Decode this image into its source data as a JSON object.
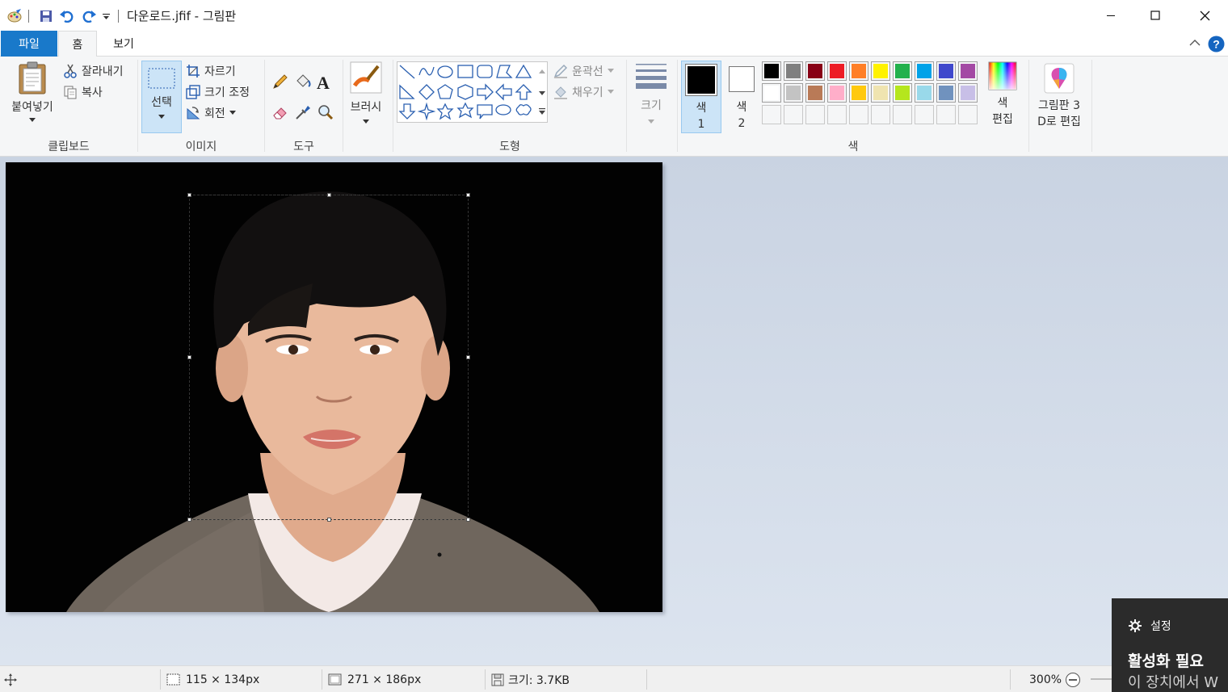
{
  "window": {
    "title": "다운로드.jfif - 그림판",
    "minimize_icon": "minimize-icon",
    "maximize_icon": "maximize-icon",
    "close_icon": "close-icon"
  },
  "tabs": {
    "file": "파일",
    "home": "홈",
    "view": "보기"
  },
  "ribbon": {
    "clipboard": {
      "paste": "붙여넣기",
      "cut": "잘라내기",
      "copy": "복사",
      "group_label": "클립보드"
    },
    "image": {
      "select": "선택",
      "crop": "자르기",
      "resize": "크기 조정",
      "rotate": "회전",
      "group_label": "이미지"
    },
    "tools": {
      "text_tool_glyph": "A",
      "group_label": "도구"
    },
    "brushes": {
      "label": "브러시"
    },
    "shapes": {
      "outline": "윤곽선",
      "fill": "채우기",
      "group_label": "도형"
    },
    "size": {
      "label": "크기"
    },
    "colors": {
      "color1_line1": "색",
      "color1_line2": "1",
      "color2_line1": "색",
      "color2_line2": "2",
      "edit_line1": "색",
      "edit_line2": "편집",
      "group_label": "색",
      "color1_value": "#000000",
      "color2_value": "#ffffff",
      "palette_row1": [
        "#000000",
        "#7f7f7f",
        "#880015",
        "#ed1c24",
        "#ff7f27",
        "#fff200",
        "#22b14c",
        "#00a2e8",
        "#3f48cc",
        "#a349a4"
      ],
      "palette_row2": [
        "#ffffff",
        "#c3c3c3",
        "#b97a57",
        "#ffaec9",
        "#ffc90e",
        "#efe4b0",
        "#b5e61d",
        "#99d9ea",
        "#7092be",
        "#c8bfe7"
      ]
    },
    "paint3d": {
      "line1": "그림판 3",
      "line2": "D로 편집"
    }
  },
  "statusbar": {
    "selection_size": "115 × 134px",
    "image_size": "271 × 186px",
    "file_size": "크기: 3.7KB",
    "zoom": "300%"
  },
  "toast": {
    "settings": "설정",
    "title": "활성화 필요",
    "body": "이 장치에서 W"
  }
}
